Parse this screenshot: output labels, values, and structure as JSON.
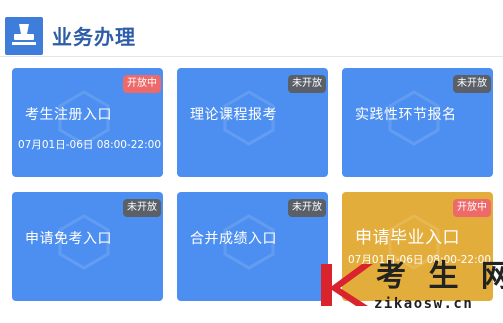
{
  "header": {
    "title": "业务办理",
    "icon": "stamp-icon"
  },
  "cards": [
    {
      "title": "考生注册入口",
      "status": "开放中",
      "status_type": "open",
      "schedule": "07月01日-06日 08:00-22:00"
    },
    {
      "title": "理论课程报考",
      "status": "未开放",
      "status_type": "closed"
    },
    {
      "title": "实践性环节报名",
      "status": "未开放",
      "status_type": "closed"
    },
    {
      "title": "申请免考入口",
      "status": "未开放",
      "status_type": "closed"
    },
    {
      "title": "合并成绩入口",
      "status": "未开放",
      "status_type": "closed"
    },
    {
      "title": "申请毕业入口",
      "status": "开放中",
      "status_type": "open",
      "schedule": "07月01日-06日 08:00-22:00"
    }
  ],
  "logo": {
    "name": "考 生 网",
    "domain": "zikaosw.cn"
  },
  "colors": {
    "card_blue": "#4d8ff0",
    "card_gold": "#e3ad3b",
    "badge_open": "#ee6a6a",
    "badge_closed": "#5b6068",
    "title_blue": "#2e5da8",
    "logo_red": "#d9232d"
  }
}
